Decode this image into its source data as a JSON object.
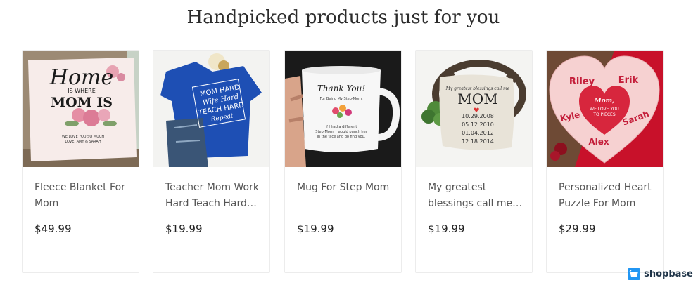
{
  "section": {
    "title": "Handpicked products just for you"
  },
  "products": [
    {
      "name": "Fleece Blanket For Mom",
      "price": "$49.99",
      "image": {
        "icon": "blanket-image",
        "text_lines": [
          "Home",
          "IS WHERE",
          "MOM IS",
          "WE LOVE YOU SO MUCH",
          "LOVE, AMY & SARAH"
        ]
      }
    },
    {
      "name": "Teacher Mom Work Hard Teach Hard Repeat",
      "price": "$19.99",
      "image": {
        "icon": "tshirt-image",
        "text_lines": [
          "MOM HARD",
          "Wife Hard",
          "TEACH HARD",
          "Repeat"
        ]
      }
    },
    {
      "name": "Mug For Step Mom",
      "price": "$19.99",
      "image": {
        "icon": "mug-image",
        "text_lines": [
          "Thank You!",
          "For Being My Step-Mom.",
          "If I had a different",
          "Step-Mom, I would punch her",
          "in the face and go find you."
        ]
      }
    },
    {
      "name": "My greatest blessings call me Mom",
      "price": "$19.99",
      "image": {
        "icon": "pillow-image",
        "text_lines": [
          "My greatest blessings call me",
          "MOM",
          "10.29.2008",
          "05.12.2010",
          "01.04.2012",
          "12.18.2014"
        ]
      }
    },
    {
      "name": "Personalized Heart Puzzle For Mom",
      "price": "$29.99",
      "image": {
        "icon": "heart-puzzle-image",
        "text_lines": [
          "Riley",
          "Erik",
          "Mom,",
          "WE LOVE YOU",
          "TO PIECES",
          "Kyle",
          "Sarah",
          "Alex"
        ]
      }
    }
  ],
  "branding": {
    "name": "shopbase",
    "icon": "shopbase-logo-icon",
    "color": "#2196f3"
  }
}
